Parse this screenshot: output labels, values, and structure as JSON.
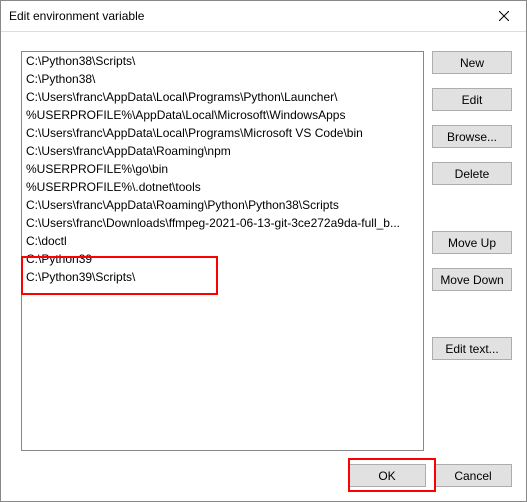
{
  "title": "Edit environment variable",
  "list": {
    "items": [
      "C:\\Python38\\Scripts\\",
      "C:\\Python38\\",
      "C:\\Users\\franc\\AppData\\Local\\Programs\\Python\\Launcher\\",
      "%USERPROFILE%\\AppData\\Local\\Microsoft\\WindowsApps",
      "C:\\Users\\franc\\AppData\\Local\\Programs\\Microsoft VS Code\\bin",
      "C:\\Users\\franc\\AppData\\Roaming\\npm",
      "%USERPROFILE%\\go\\bin",
      "%USERPROFILE%\\.dotnet\\tools",
      "C:\\Users\\franc\\AppData\\Roaming\\Python\\Python38\\Scripts",
      "C:\\Users\\franc\\Downloads\\ffmpeg-2021-06-13-git-3ce272a9da-full_b...",
      "C:\\doctl",
      "C:\\Python39",
      "C:\\Python39\\Scripts\\"
    ]
  },
  "buttons": {
    "new": "New",
    "edit": "Edit",
    "browse": "Browse...",
    "delete": "Delete",
    "moveUp": "Move Up",
    "moveDown": "Move Down",
    "editText": "Edit text...",
    "ok": "OK",
    "cancel": "Cancel"
  }
}
